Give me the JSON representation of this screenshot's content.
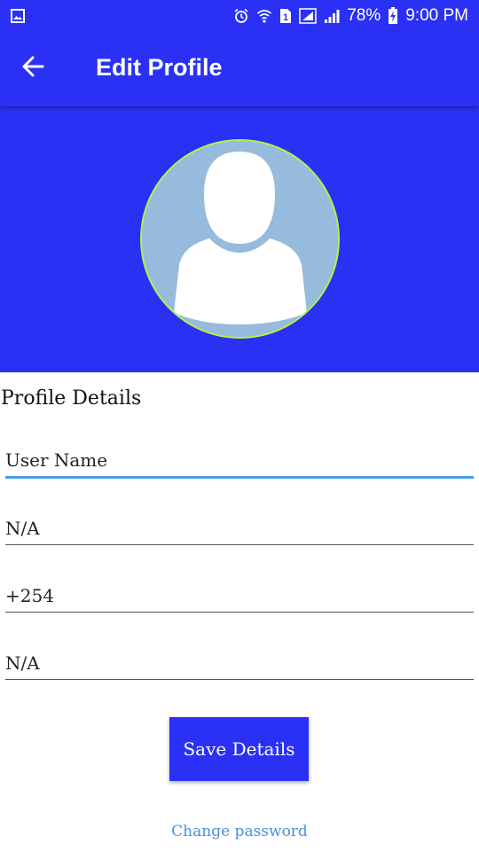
{
  "status_bar": {
    "battery": "78%",
    "time": "9:00 PM",
    "sim_slot": "1",
    "icons": [
      "gallery-icon",
      "alarm-icon",
      "wifi-icon",
      "sim-icon",
      "signal-icon",
      "signal-icon",
      "battery-charging-icon"
    ]
  },
  "app_bar": {
    "title": "Edit Profile",
    "back_icon": "arrow-left-icon"
  },
  "profile": {
    "avatar_icon": "person-placeholder-icon",
    "section_title": "Profile Details"
  },
  "form": {
    "fields": [
      {
        "value": "User Name"
      },
      {
        "value": "N/A"
      },
      {
        "value": "+254"
      },
      {
        "value": "N/A"
      }
    ],
    "save_label": "Save Details",
    "change_password_label": "Change password"
  },
  "colors": {
    "primary": "#2a31f5",
    "avatar_bg": "#96bbdc",
    "avatar_border": "#b7f04a",
    "focus_underline": "#4a9be8",
    "link": "#4a8fe0"
  }
}
